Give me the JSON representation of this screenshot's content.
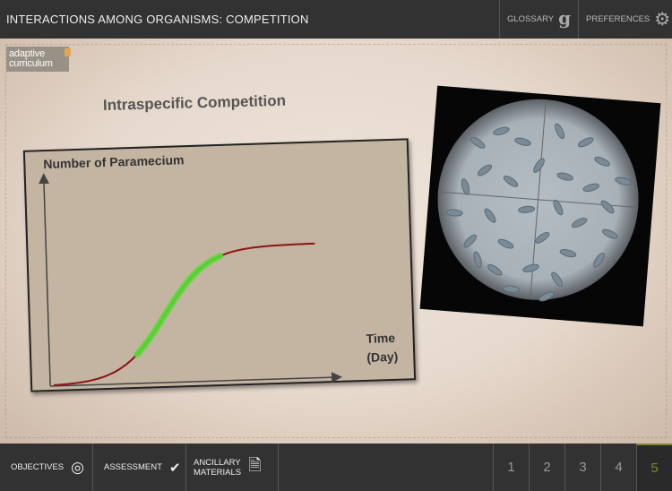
{
  "header": {
    "title": "INTERACTIONS AMONG ORGANISMS: COMPETITION",
    "glossary_label": "GLOSSARY",
    "preferences_label": "PREFERENCES"
  },
  "logo": {
    "line1": "adaptive",
    "line2": "curriculum"
  },
  "content": {
    "heading": "Intraspecific Competition",
    "graph": {
      "y_label": "Number of Paramecium",
      "x_label_line1": "Time",
      "x_label_line2": "(Day)",
      "curve_color": "#8b1414",
      "highlight_color": "#55dd33"
    }
  },
  "footer": {
    "objectives_label": "OBJECTIVES",
    "assessment_label": "ASSESSMENT",
    "ancillary_line1": "ANCILLARY",
    "ancillary_line2": "MATERIALS",
    "pages": [
      "1",
      "2",
      "3",
      "4",
      "5"
    ],
    "active_page": "5"
  }
}
